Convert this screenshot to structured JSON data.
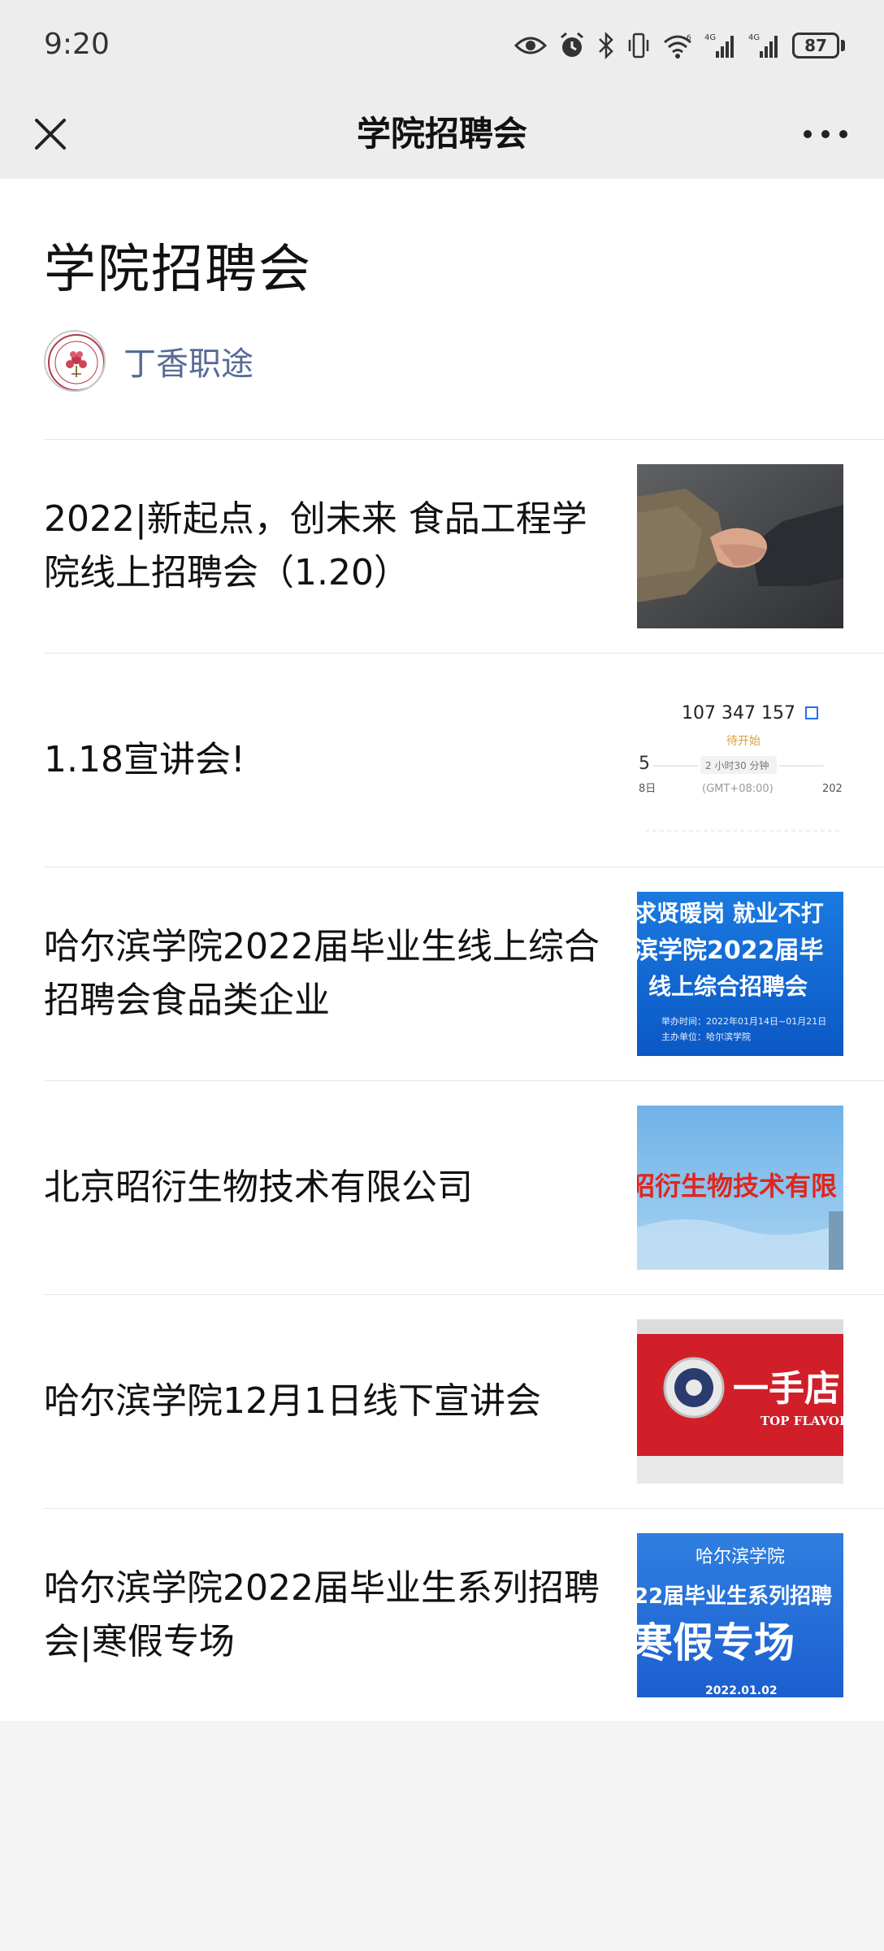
{
  "status_bar": {
    "time": "9:20",
    "signal_label_1": "4G",
    "signal_label_2": "4G",
    "wifi_label": "6",
    "battery": "87"
  },
  "nav": {
    "title": "学院招聘会",
    "close_icon": "close-icon",
    "more_icon": "more-icon"
  },
  "page": {
    "title": "学院招聘会",
    "account_name": "丁香职途"
  },
  "articles": [
    {
      "title": "2022|新起点，创未来 食品工程学院线上招聘会（1.20）",
      "thumb": "handshake"
    },
    {
      "title": "1.18宣讲会!",
      "thumb": "meeting-screenshot",
      "thumb_text": {
        "meeting_id": "107 347 157",
        "status": "待开始",
        "duration": "2 小时30 分钟",
        "left_num": "5",
        "left_day": "8日",
        "timezone": "(GMT+08:00)",
        "right_year": "202"
      }
    },
    {
      "title": "哈尔滨学院2022届毕业生线上综合招聘会食品类企业",
      "thumb": "blue-poster",
      "thumb_text": {
        "line1": "求贤暖岗  就业不打",
        "line2": "滨学院2022届毕",
        "line3": "线上综合招聘会",
        "line4": "举办时间：2022年01月14日~01月21日",
        "line5": "主办单位：哈尔滨学院"
      }
    },
    {
      "title": "北京昭衍生物技术有限公司",
      "thumb": "company-sign",
      "thumb_text": {
        "sign": "昭衍生物技术有限"
      }
    },
    {
      "title": "哈尔滨学院12月1日线下宣讲会",
      "thumb": "red-sign",
      "thumb_text": {
        "brand_cn": "一手店",
        "brand_en": "TOP FLAVOR"
      }
    },
    {
      "title": "哈尔滨学院2022届毕业生系列招聘会|寒假专场",
      "thumb": "winter-poster",
      "thumb_text": {
        "line1": "哈尔滨学院",
        "line2": "22届毕业生系列招聘",
        "line3": "寒假专场",
        "line4": "2022.01.02"
      }
    }
  ],
  "colors": {
    "bar_bg": "#ededed",
    "link": "#576b95",
    "divider": "#e5e5e5"
  }
}
